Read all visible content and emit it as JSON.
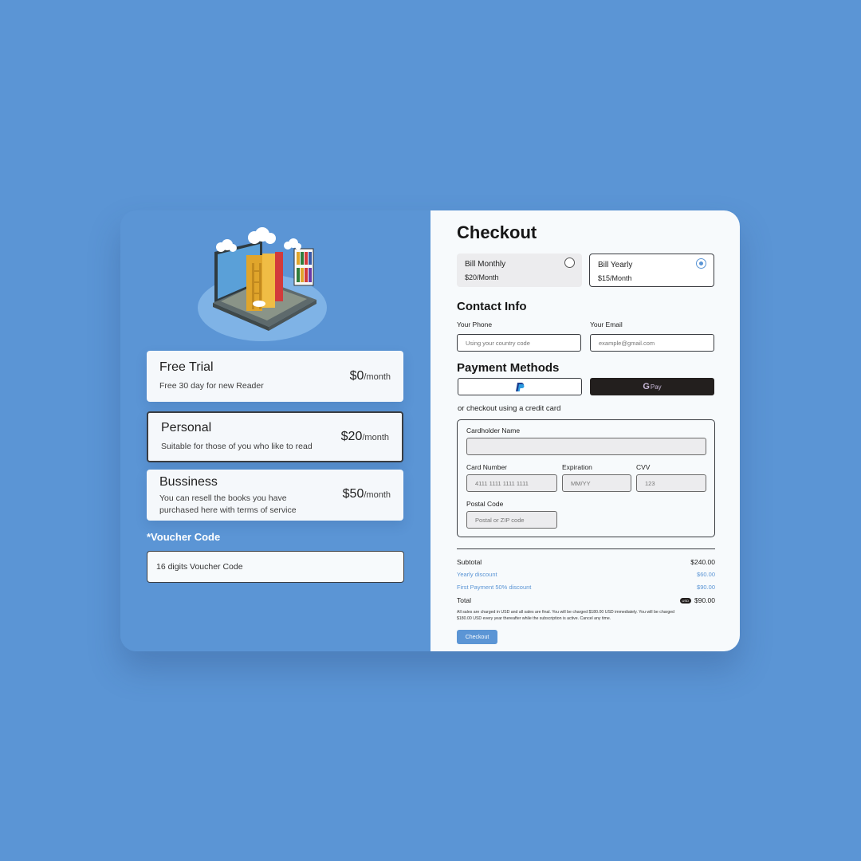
{
  "plans": [
    {
      "name": "Free Trial",
      "desc": "Free 30 day for new Reader",
      "price": "$0",
      "unit": "/month"
    },
    {
      "name": "Personal",
      "desc": "Suitable for those of you who like to read",
      "price": "$20",
      "unit": "/month"
    },
    {
      "name": "Bussiness",
      "desc_line1": "You can resell the books you have",
      "desc_line2": "purchased here with terms of service",
      "price": "$50",
      "unit": "/month"
    }
  ],
  "voucher": {
    "label": "*Voucher Code",
    "value": "16 digits Voucher Code"
  },
  "checkout": {
    "title": "Checkout",
    "billing": [
      {
        "label": "Bill Monthly",
        "price": "$20/Month"
      },
      {
        "label": "Bill Yearly",
        "price": "$15/Month"
      }
    ],
    "contact_title": "Contact Info",
    "phone_label": "Your Phone",
    "phone_placeholder": "Using your country code",
    "email_label": "Your Email",
    "email_placeholder": "example@gmail.com",
    "payment_title": "Payment Methods",
    "paypal_icon": "paypal-logo",
    "gpay_label": "Pay",
    "card_divider": "or checkout using a credit card",
    "cardholder_label": "Cardholder Name",
    "card_number_label": "Card Number",
    "card_number_value": "4111 1111 1111 1111",
    "expiration_label": "Expiration",
    "expiration_placeholder": "MM/YY",
    "cvv_label": "CVV",
    "cvv_placeholder": "123",
    "postal_label": "Postal Code",
    "postal_placeholder": "Postal or ZIP code",
    "summary": {
      "subtotal_label": "Subtotal",
      "subtotal_value": "$240.00",
      "yearly_label": "Yearly discount",
      "yearly_value": "$60.00",
      "first_label": "First Payment 50% discount",
      "first_value": "$90.00",
      "total_label": "Total",
      "total_badge": "USD",
      "total_value": "$90.00",
      "note_line1": "All sales are charged in USD and all sales are final. You will be charged $180.00 USD immediately. You will be charged",
      "note_line2": "$180.00 USD every year thereafter while the subscription is active. Cancel any time."
    },
    "button_label": "Checkout"
  },
  "colors": {
    "accent": "#5b95d5",
    "background": "#5b95d5",
    "panel": "#f7fafc",
    "dark": "#231f1e"
  }
}
